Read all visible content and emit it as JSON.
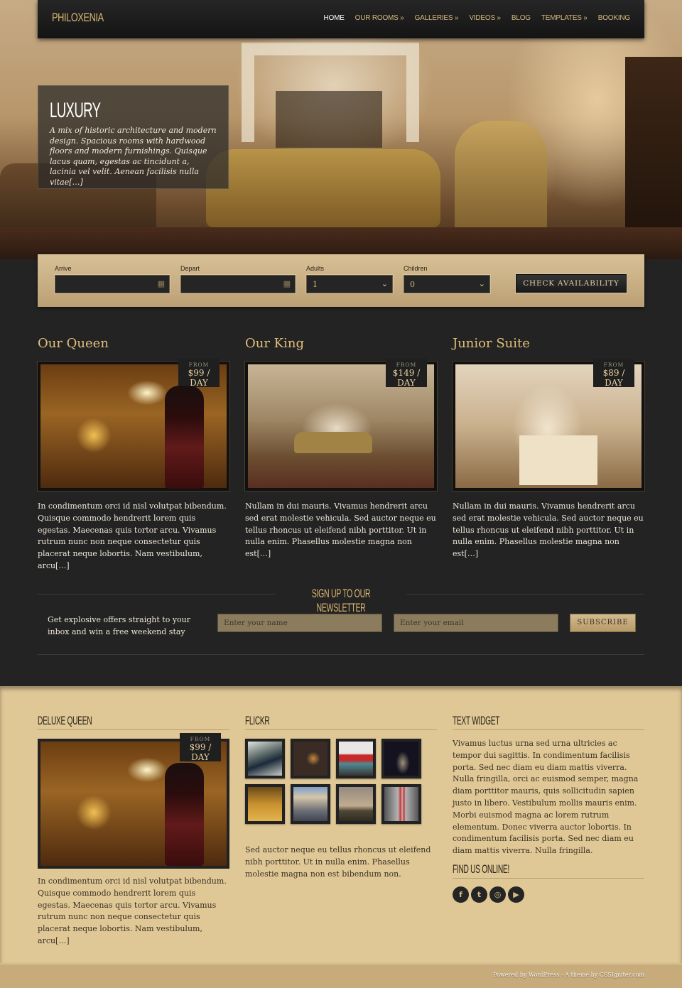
{
  "header": {
    "logo": "PHILOXENIA",
    "nav": [
      {
        "label": "HOME",
        "active": true
      },
      {
        "label": "OUR ROOMS »"
      },
      {
        "label": "GALLERIES »"
      },
      {
        "label": "VIDEOS »"
      },
      {
        "label": "BLOG"
      },
      {
        "label": "TEMPLATES »"
      },
      {
        "label": "BOOKING"
      }
    ]
  },
  "slide": {
    "title": "LUXURY",
    "text": "A mix of historic architecture and modern design. Spacious rooms with hardwood floors and modern furnishings. Quisque lacus quam, egestas ac tincidunt a, lacinia vel velit. Aenean facilisis nulla vitae[…]"
  },
  "booking": {
    "arrive_label": "Arrive",
    "arrive_value": "",
    "depart_label": "Depart",
    "depart_value": "",
    "adults_label": "Adults",
    "adults_value": "1",
    "children_label": "Children",
    "children_value": "0",
    "calendar_icon": "calendar-icon",
    "dropdown_icon": "chevron-down-icon",
    "check_button": "CHECK AVAILABILITY"
  },
  "rooms": [
    {
      "title": "Our Queen",
      "price_from": "FROM",
      "price": "$99 / DAY",
      "text": "In condimentum orci id nisl volutpat bibendum. Quisque commodo hendrerit lorem quis egestas. Maecenas quis tortor arcu. Vivamus rutrum nunc non neque consectetur quis placerat neque lobortis. Nam vestibulum, arcu[…]"
    },
    {
      "title": "Our King",
      "price_from": "FROM",
      "price": "$149 / DAY",
      "text": "Nullam in dui mauris. Vivamus hendrerit arcu sed erat molestie vehicula. Sed auctor neque eu tellus rhoncus ut eleifend nibh porttitor. Ut in nulla enim. Phasellus molestie magna non est[…]"
    },
    {
      "title": "Junior Suite",
      "price_from": "FROM",
      "price": "$89 / DAY",
      "text": "Nullam in dui mauris. Vivamus hendrerit arcu sed erat molestie vehicula. Sed auctor neque eu tellus rhoncus ut eleifend nibh porttitor. Ut in nulla enim. Phasellus molestie magna non est[…]"
    }
  ],
  "newsletter": {
    "title": "SIGN UP TO OUR NEWSLETTER",
    "text": "Get explosive offers straight to your inbox and win a free weekend stay",
    "name_placeholder": "Enter your name",
    "email_placeholder": "Enter your email",
    "subscribe_button": "SUBSCRIBE"
  },
  "footer": {
    "deluxe": {
      "title": "DELUXE QUEEN",
      "price_from": "FROM",
      "price": "$99 / DAY",
      "text": "In condimentum orci id nisl volutpat bibendum. Quisque commodo hendrerit lorem quis egestas. Maecenas quis tortor arcu. Vivamus rutrum nunc non neque consectetur quis placerat neque lobortis. Nam vestibulum, arcu[…]"
    },
    "flickr": {
      "title": "FLICKR",
      "photos": [
        "speedometer",
        "robot-figure",
        "red-car",
        "tower-night",
        "street-night",
        "plaza-aerial",
        "harbor-tower",
        "chrome-sculpture"
      ],
      "text": "Sed auctor neque eu tellus rhoncus ut eleifend nibh porttitor. Ut in nulla enim. Phasellus molestie magna non est bibendum non."
    },
    "text_widget": {
      "title": "TEXT WIDGET",
      "text": "Vivamus luctus urna sed urna ultricies ac tempor dui sagittis. In condimentum facilisis porta. Sed nec diam eu diam mattis viverra. Nulla fringilla, orci ac euismod semper, magna diam porttitor mauris, quis sollicitudin sapien justo in libero. Vestibulum mollis mauris enim. Morbi euismod magna ac lorem rutrum elementum. Donec viverra auctor lobortis. In condimentum facilisis porta. Sed nec diam eu diam mattis viverra. Nulla fringilla."
    },
    "find_us": {
      "title": "FIND US ONLINE!",
      "icons": [
        {
          "name": "facebook-icon",
          "glyph": "f"
        },
        {
          "name": "twitter-icon",
          "glyph": "t"
        },
        {
          "name": "dribbble-icon",
          "glyph": "◎"
        },
        {
          "name": "youtube-icon",
          "glyph": "▶"
        }
      ]
    },
    "credits": "Powered by WordPress - A theme by CSSIgniter.com"
  },
  "colors": {
    "accent_gold": "#e0c07c",
    "dark_bg": "#232323",
    "footer_bg": "#dfc796"
  }
}
